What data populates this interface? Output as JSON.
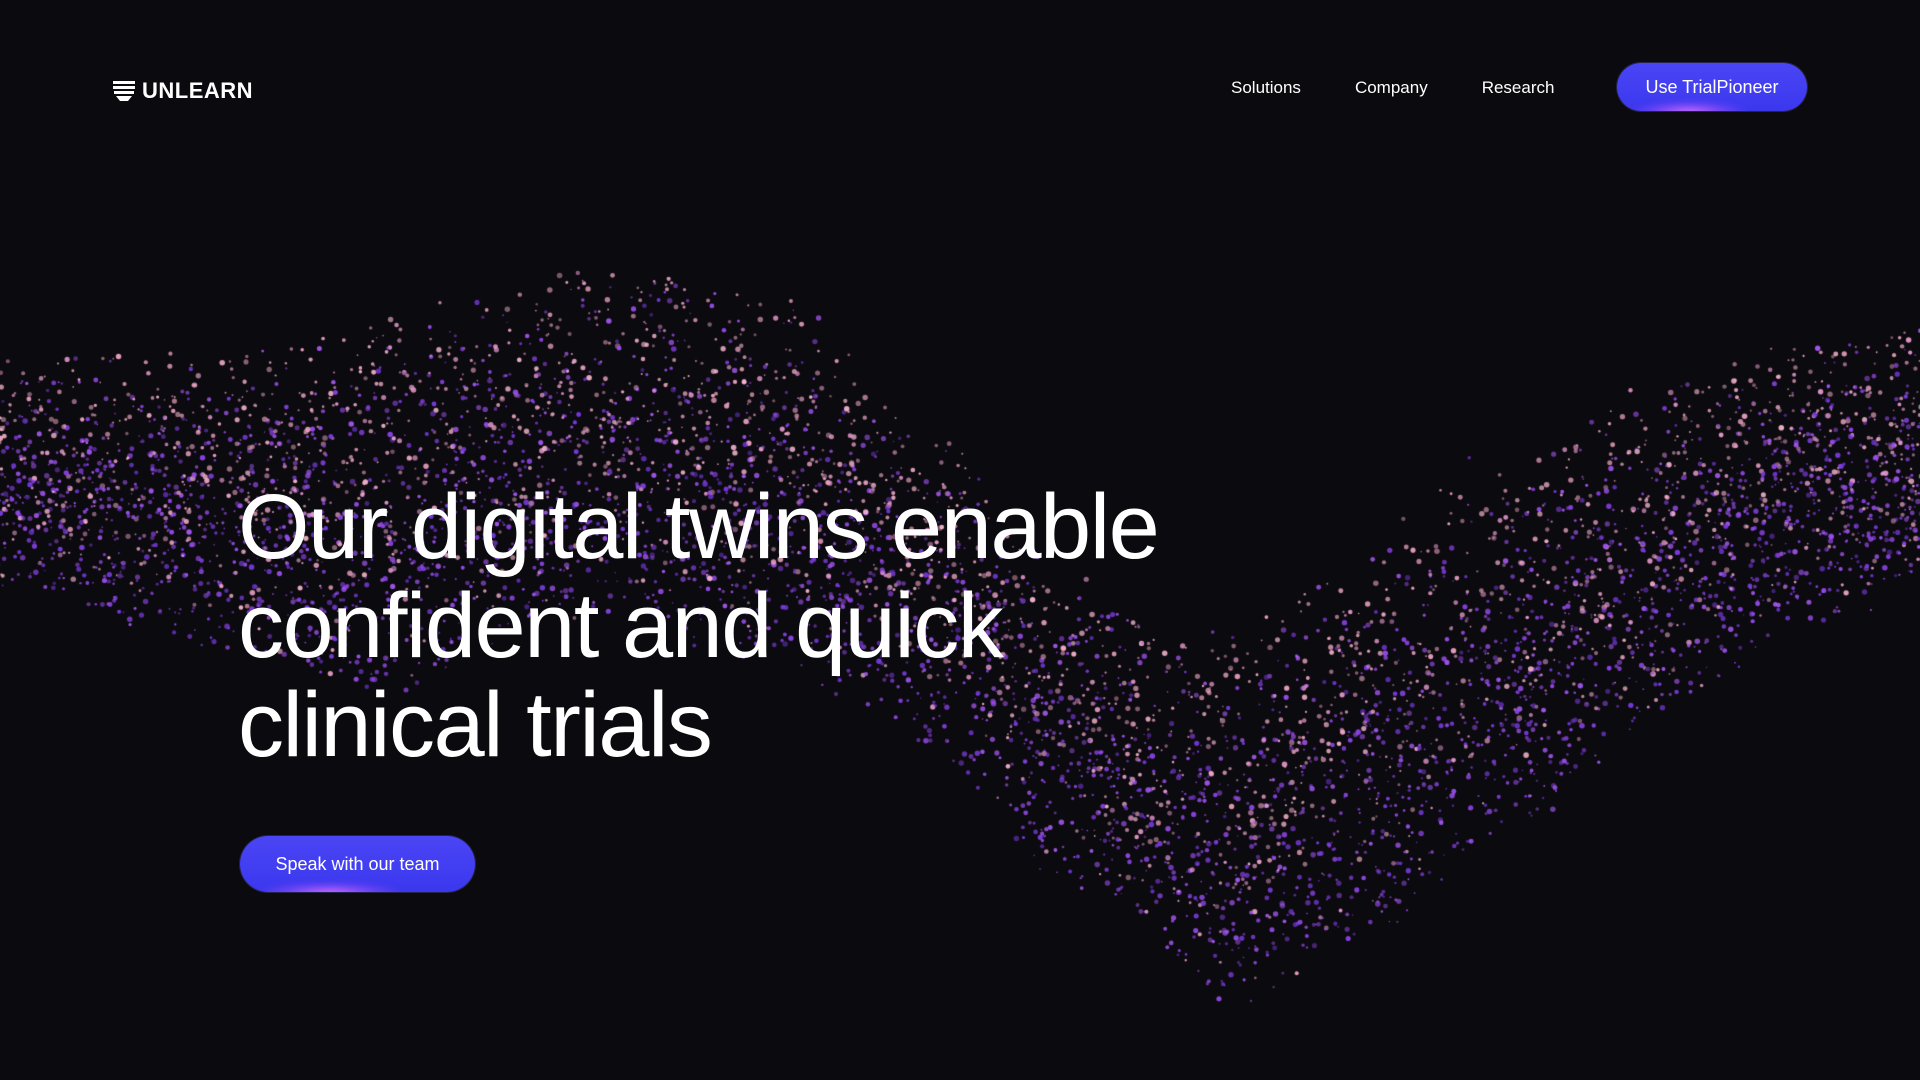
{
  "brand": {
    "name": "UNLEARN",
    "logo_icon": "unlearn-logo-icon"
  },
  "nav": {
    "items": [
      {
        "label": "Solutions"
      },
      {
        "label": "Company"
      },
      {
        "label": "Research"
      }
    ],
    "cta_label": "Use TrialPioneer"
  },
  "hero": {
    "headline_lines": [
      "Our digital twins enable",
      "confident and quick",
      "clinical trials"
    ],
    "cta_label": "Speak with our team"
  },
  "colors": {
    "background": "#0b0a0e",
    "button": "#4a46f5",
    "particle_pink": "#f0a6c8",
    "particle_purple": "#9b4ef0"
  }
}
